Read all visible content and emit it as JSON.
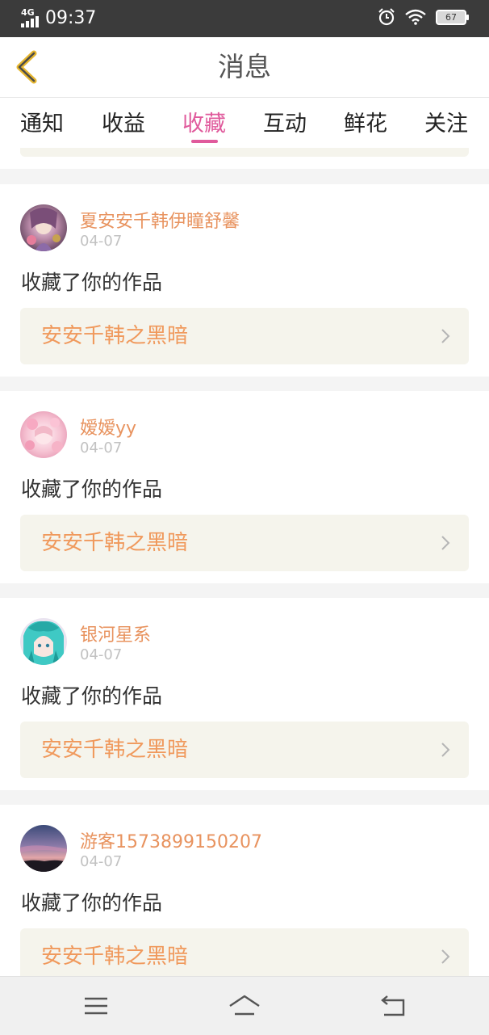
{
  "statusbar": {
    "network": "4G",
    "time": "09:37",
    "battery": "67"
  },
  "header": {
    "title": "消息"
  },
  "tabs": [
    {
      "label": "通知",
      "active": false
    },
    {
      "label": "收益",
      "active": false
    },
    {
      "label": "收藏",
      "active": true
    },
    {
      "label": "互动",
      "active": false
    },
    {
      "label": "鲜花",
      "active": false
    },
    {
      "label": "关注",
      "active": false
    }
  ],
  "accent_color": "#e05a9c",
  "name_color": "#e8935f",
  "items": [
    {
      "user": "夏安安千韩伊瞳舒馨",
      "date": "04-07",
      "action": "收藏了你的作品",
      "work": "安安千韩之黑暗",
      "avatar": "avatar-anime-colorful"
    },
    {
      "user": "嫒嫒yy",
      "date": "04-07",
      "action": "收藏了你的作品",
      "work": "安安千韩之黑暗",
      "avatar": "avatar-pink-flowers"
    },
    {
      "user": "银河星系",
      "date": "04-07",
      "action": "收藏了你的作品",
      "work": "安安千韩之黑暗",
      "avatar": "avatar-teal-hair"
    },
    {
      "user": "游客1573899150207",
      "date": "04-07",
      "action": "收藏了你的作品",
      "work": "安安千韩之黑暗",
      "avatar": "avatar-sunset-sky"
    }
  ],
  "icons": {
    "back": "back-chevron-icon",
    "menu": "menu-icon",
    "home": "home-icon",
    "return": "return-icon"
  }
}
